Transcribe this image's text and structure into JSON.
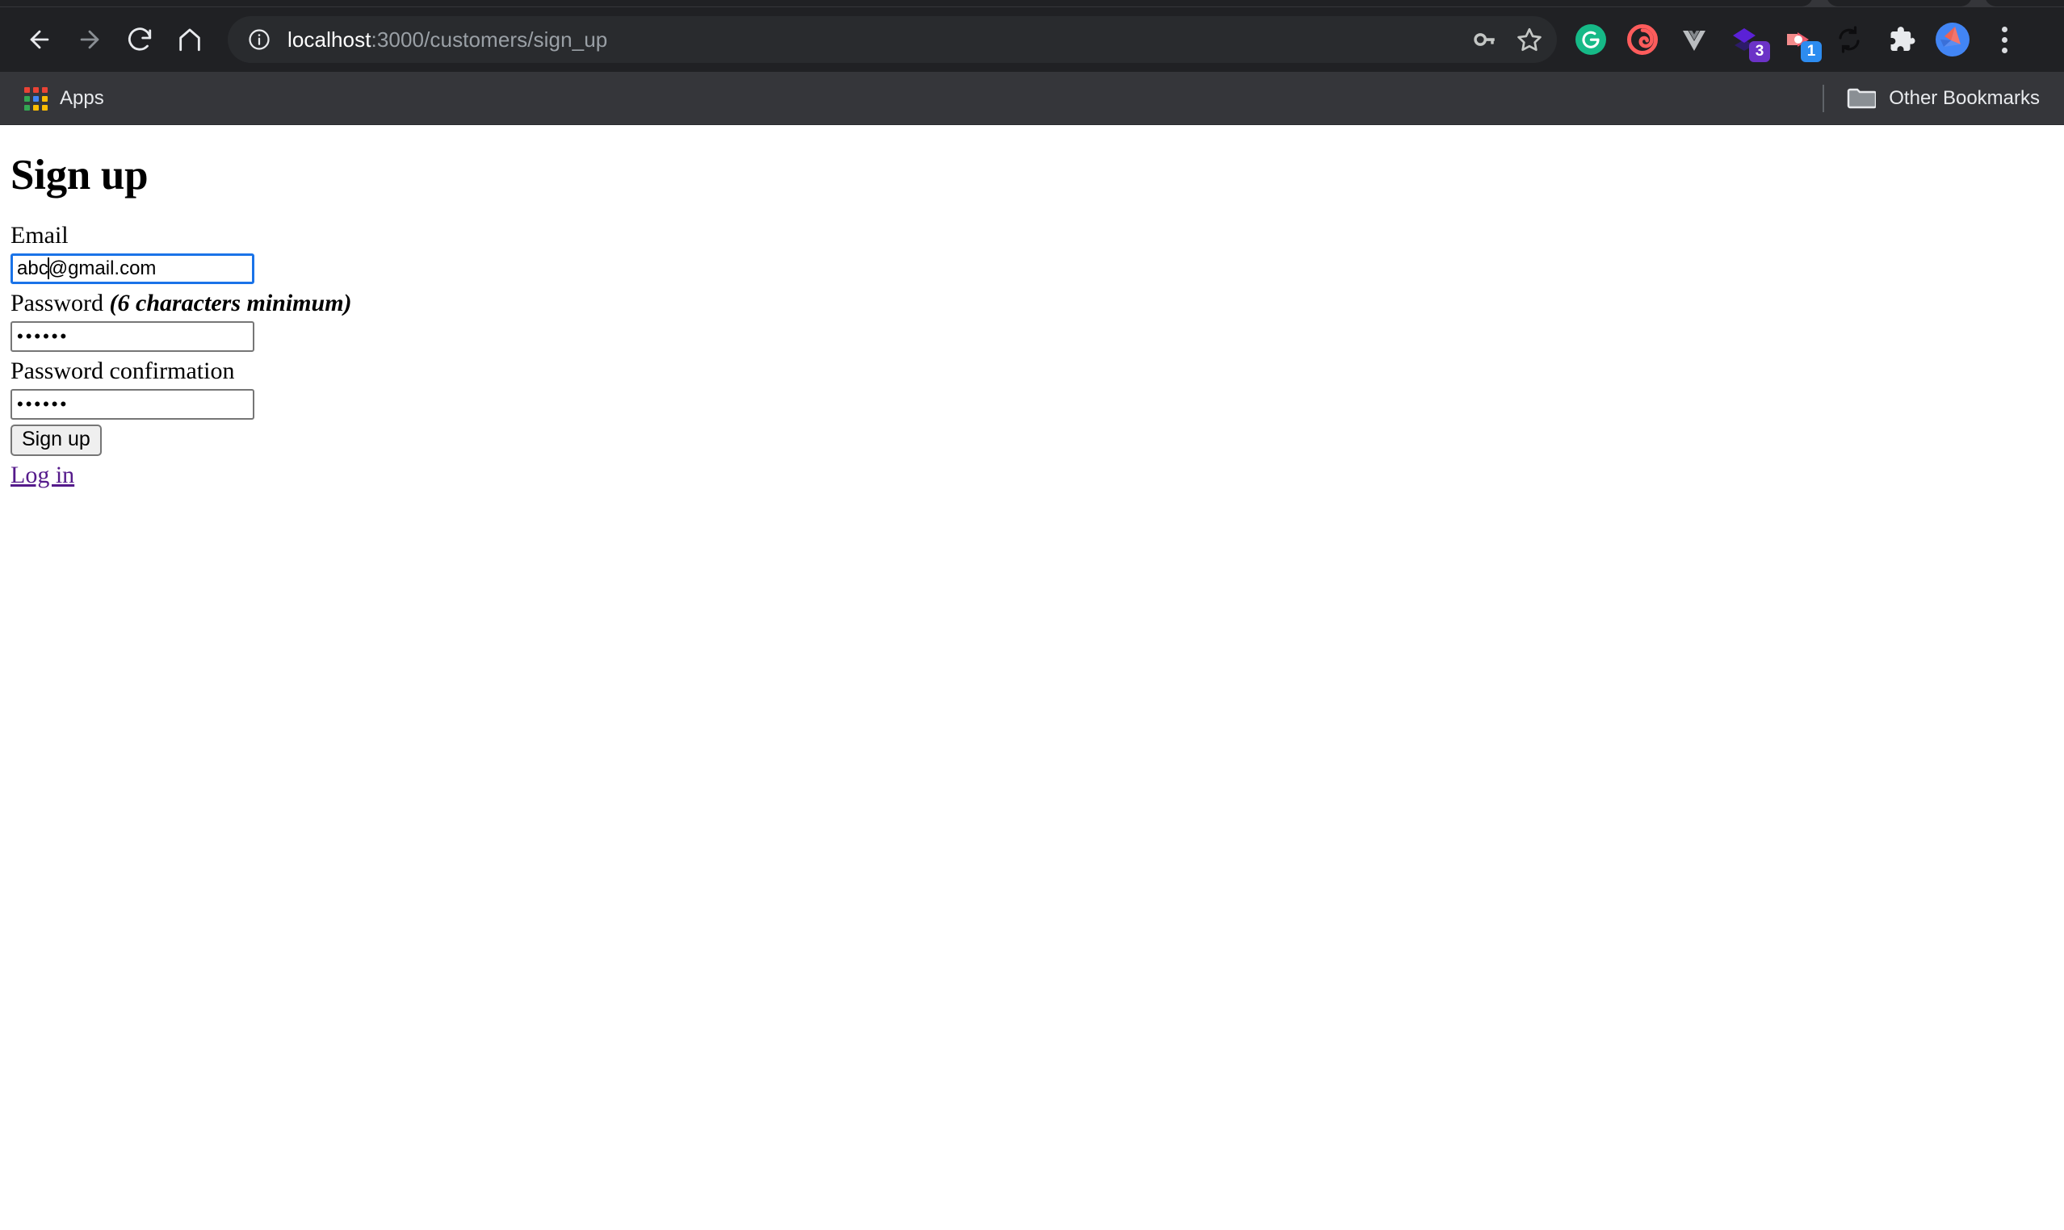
{
  "browser": {
    "nav": {
      "back": "back-arrow",
      "forward": "forward-arrow",
      "reload": "reload",
      "home": "home"
    },
    "omnibox": {
      "site_info_icon": "info-circle-icon",
      "url_host": "localhost",
      "url_path": ":3000/customers/sign_up",
      "full_url": "localhost:3000/customers/sign_up",
      "actions": [
        {
          "name": "password-key-icon",
          "label": "key"
        },
        {
          "name": "bookmark-star-icon",
          "label": "star"
        }
      ]
    },
    "extensions": [
      {
        "name": "grammarly-extension-icon",
        "label": "G",
        "color": "#16b987",
        "badge": null
      },
      {
        "name": "loom-extension-icon",
        "label": "spiral",
        "color": "#ff5c5c",
        "badge": null
      },
      {
        "name": "vue-devtools-extension-icon",
        "label": "V",
        "color": "#9aa0a6",
        "badge": null
      },
      {
        "name": "layers-extension-icon",
        "label": "layers",
        "color": "#5b21b6",
        "badge": "3"
      },
      {
        "name": "recorder-extension-icon",
        "label": "record",
        "color": "#ef5b6b",
        "badge": "1"
      },
      {
        "name": "sync-extension-icon",
        "label": "sync",
        "color": "#0b0b0b",
        "badge": null
      },
      {
        "name": "extensions-puzzle-icon",
        "label": "puzzle",
        "color": "#e8eaed",
        "badge": null
      }
    ],
    "profile": {
      "name": "profile-avatar",
      "color": "#4285f4"
    },
    "menu": {
      "name": "chrome-menu-icon",
      "label": "⋮"
    },
    "bookmarks_bar": {
      "apps_label": "Apps",
      "apps_icon_colors": [
        "#ea4335",
        "#ea4335",
        "#ea4335",
        "#34a853",
        "#4285f4",
        "#fbbc04",
        "#34a853",
        "#fbbc04",
        "#fbbc04"
      ],
      "other_bookmarks_label": "Other Bookmarks",
      "other_bookmarks_icon": "folder-icon"
    }
  },
  "page": {
    "title": "Sign up",
    "form": {
      "email": {
        "label": "Email",
        "value_before_caret": "abc",
        "value_after_caret": "@gmail.com",
        "value": "abc@gmail.com",
        "focused": true
      },
      "password": {
        "label": "Password ",
        "hint": "(6 characters minimum)",
        "value_masked": "••••••"
      },
      "password_confirmation": {
        "label": "Password confirmation",
        "value_masked": "••••••"
      },
      "submit_label": "Sign up"
    },
    "login_link": "Log in",
    "link_color": "#551a8b"
  }
}
